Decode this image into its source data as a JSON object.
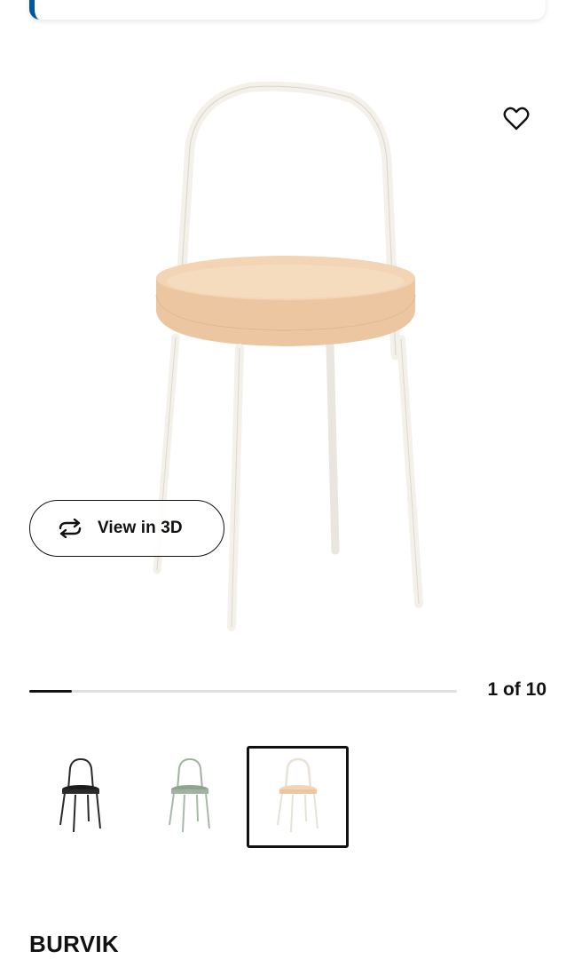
{
  "product": {
    "name": "BURVIK"
  },
  "gallery": {
    "view_3d_label": "View in 3D",
    "counter": "1 of 10",
    "current_index": 1,
    "total": 10,
    "thumbnails": [
      {
        "color_name": "black",
        "table_color": "#2a2a2a",
        "frame_color": "#2a2a2a"
      },
      {
        "color_name": "green",
        "table_color": "#9fb39f",
        "frame_color": "#9fb39f"
      },
      {
        "color_name": "white-birch",
        "table_color": "#f1cfae",
        "frame_color": "#f4f1ea"
      }
    ],
    "selected_thumbnail": 2
  },
  "colors": {
    "accent": "#0058a3",
    "text": "#111111",
    "track": "#dfdfdf",
    "birch": "#f1cfae",
    "frame_white": "#f4f1ea"
  },
  "icons": {
    "favorite": "heart-icon",
    "view3d": "rotate-3d-icon"
  }
}
